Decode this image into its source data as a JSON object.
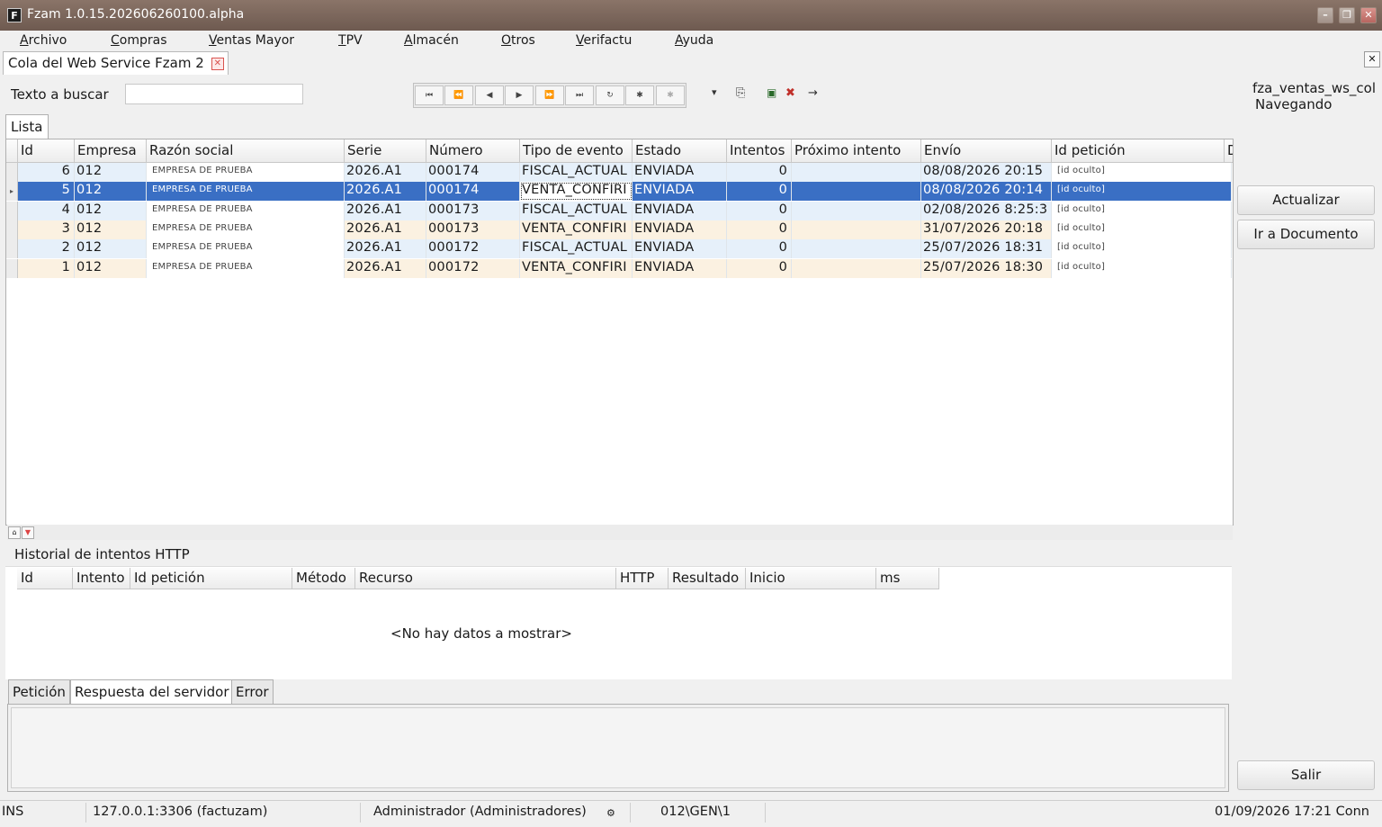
{
  "window": {
    "title": "Fzam 1.0.15.202606260100.alpha",
    "app_icon": "F",
    "minimize": "–",
    "restore": "❐",
    "close": "✕"
  },
  "menu": [
    "Archivo",
    "Compras",
    "Ventas Mayor",
    "TPV",
    "Almacén",
    "Otros",
    "Verifactu",
    "Ayuda"
  ],
  "doc_tab": {
    "label": "Cola del Web Service Fzam 2",
    "close": "✕"
  },
  "search": {
    "label": "Texto a buscar",
    "value": ""
  },
  "nav": [
    "⏮",
    "⏪",
    "◀",
    "▶",
    "⏩",
    "⏭",
    "↻",
    "✱",
    "✱"
  ],
  "right_info": {
    "line1": "fza_ventas_ws_col",
    "line2": "Navegando"
  },
  "list_tab": "Lista",
  "grid": {
    "headers": [
      "Id",
      "Empresa",
      "Razón social",
      "Serie",
      "Número",
      "Tipo de evento",
      "Estado",
      "Intentos",
      "Próximo intento",
      "Envío",
      "Id petición",
      "D"
    ],
    "rows": [
      {
        "id": "6",
        "empresa": "012",
        "razon": "EMPRESA DE PRUEBA",
        "serie": "2026.A1",
        "numero": "000174",
        "tipo": "FISCAL_ACTUAL",
        "estado": "ENVIADA",
        "intentos": "0",
        "proximo": "",
        "envio": "08/08/2026 20:15",
        "peticion": "[id oculto]",
        "selected": false
      },
      {
        "id": "5",
        "empresa": "012",
        "razon": "EMPRESA DE PRUEBA",
        "serie": "2026.A1",
        "numero": "000174",
        "tipo": "VENTA_CONFIRI",
        "estado": "ENVIADA",
        "intentos": "0",
        "proximo": "",
        "envio": "08/08/2026 20:14",
        "peticion": "[id oculto]",
        "selected": true
      },
      {
        "id": "4",
        "empresa": "012",
        "razon": "EMPRESA DE PRUEBA",
        "serie": "2026.A1",
        "numero": "000173",
        "tipo": "FISCAL_ACTUAL",
        "estado": "ENVIADA",
        "intentos": "0",
        "proximo": "",
        "envio": "02/08/2026 8:25:3",
        "peticion": "[id oculto]",
        "selected": false
      },
      {
        "id": "3",
        "empresa": "012",
        "razon": "EMPRESA DE PRUEBA",
        "serie": "2026.A1",
        "numero": "000173",
        "tipo": "VENTA_CONFIRI",
        "estado": "ENVIADA",
        "intentos": "0",
        "proximo": "",
        "envio": "31/07/2026 20:18",
        "peticion": "[id oculto]",
        "selected": false
      },
      {
        "id": "2",
        "empresa": "012",
        "razon": "EMPRESA DE PRUEBA",
        "serie": "2026.A1",
        "numero": "000172",
        "tipo": "FISCAL_ACTUAL",
        "estado": "ENVIADA",
        "intentos": "0",
        "proximo": "",
        "envio": "25/07/2026 18:31",
        "peticion": "[id oculto]",
        "selected": false
      },
      {
        "id": "1",
        "empresa": "012",
        "razon": "EMPRESA DE PRUEBA",
        "serie": "2026.A1",
        "numero": "000172",
        "tipo": "VENTA_CONFIRI",
        "estado": "ENVIADA",
        "intentos": "0",
        "proximo": "",
        "envio": "25/07/2026 18:30",
        "peticion": "[id oculto]",
        "selected": false
      }
    ],
    "row_colors": [
      "#e6f0fa",
      "#3a6fc4",
      "#e6f0fa",
      "#fbf1e1",
      "#e6f0fa",
      "#fbf1e1"
    ]
  },
  "history": {
    "title": "Historial de intentos HTTP",
    "headers": [
      "Id",
      "Intento",
      "Id petición",
      "Método",
      "Recurso",
      "HTTP",
      "Resultado",
      "Inicio",
      "ms"
    ],
    "empty": "<No hay datos a mostrar>"
  },
  "bottom_tabs": [
    "Petición",
    "Respuesta del servidor",
    "Error"
  ],
  "buttons": {
    "refresh": "Actualizar",
    "goto_doc": "Ir a Documento",
    "exit": "Salir"
  },
  "status": {
    "mode": "INS",
    "db": "127.0.0.1:3306 (factuzam)",
    "user": "Administrador (Administradores)",
    "path": "012\\GEN\\1",
    "datetime": "01/09/2026 17:21 Conn"
  },
  "colors": {
    "selection": "#3a6fc4",
    "titlebar": "#7a665b"
  }
}
